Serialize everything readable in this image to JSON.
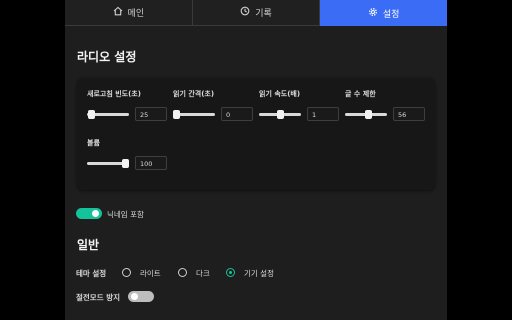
{
  "tabs": [
    {
      "label": "메인",
      "icon": "home-icon",
      "active": false
    },
    {
      "label": "기록",
      "icon": "history-icon",
      "active": false
    },
    {
      "label": "설정",
      "icon": "gear-icon",
      "active": true
    }
  ],
  "radio_settings": {
    "heading": "라디오 설정",
    "controls": [
      {
        "label": "새로고침 빈도(초)",
        "value": "25"
      },
      {
        "label": "읽기 간격(초)",
        "value": "0"
      },
      {
        "label": "읽기 속도(배)",
        "value": "1"
      },
      {
        "label": "글 수 제한",
        "value": "56"
      },
      {
        "label": "볼륨",
        "value": "100"
      }
    ]
  },
  "include_nickname": {
    "label": "닉네임 포함",
    "on": true
  },
  "general": {
    "heading": "일반",
    "theme_label": "테마 설정",
    "theme_options": [
      "라이트",
      "다크",
      "기기 설정"
    ],
    "theme_selected": "기기 설정",
    "power_save_label": "절전모드 방지",
    "power_save_on": false
  },
  "colors": {
    "accent": "#15c39a",
    "tab_active": "#3b6cf6"
  }
}
